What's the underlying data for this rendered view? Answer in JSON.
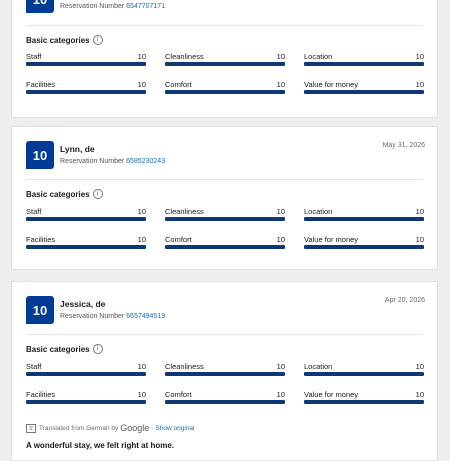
{
  "basic_categories_label": "Basic categories",
  "reservation_label": "Reservation Number",
  "reviews": [
    {
      "score": "10",
      "name": "",
      "date": "",
      "reservation_number": "6547707171",
      "categories": [
        {
          "label": "Staff",
          "value": "10"
        },
        {
          "label": "Cleanliness",
          "value": "10"
        },
        {
          "label": "Location",
          "value": "10"
        },
        {
          "label": "Facilities",
          "value": "10"
        },
        {
          "label": "Comfort",
          "value": "10"
        },
        {
          "label": "Value for money",
          "value": "10"
        }
      ]
    },
    {
      "score": "10",
      "name": "Lynn, de",
      "date": "May 31, 2026",
      "reservation_number": "6585230243",
      "categories": [
        {
          "label": "Staff",
          "value": "10"
        },
        {
          "label": "Cleanliness",
          "value": "10"
        },
        {
          "label": "Location",
          "value": "10"
        },
        {
          "label": "Facilities",
          "value": "10"
        },
        {
          "label": "Comfort",
          "value": "10"
        },
        {
          "label": "Value for money",
          "value": "10"
        }
      ]
    },
    {
      "score": "10",
      "name": "Jessica, de",
      "date": "Apr 20, 2026",
      "reservation_number": "6657494519",
      "categories": [
        {
          "label": "Staff",
          "value": "10"
        },
        {
          "label": "Cleanliness",
          "value": "10"
        },
        {
          "label": "Location",
          "value": "10"
        },
        {
          "label": "Facilities",
          "value": "10"
        },
        {
          "label": "Comfort",
          "value": "10"
        },
        {
          "label": "Value for money",
          "value": "10"
        }
      ],
      "translation": {
        "prefix": "Translated from German by",
        "provider": "Google",
        "separator": "·",
        "show_original": "Show original"
      },
      "review_title": "A wonderful stay, we felt right at home."
    }
  ],
  "colors": {
    "score_badge": "#003b95",
    "bar_fill": "#0e3778",
    "link": "#1a6fb3"
  },
  "icons": {
    "info": "info-icon",
    "translate": "translate-icon"
  }
}
